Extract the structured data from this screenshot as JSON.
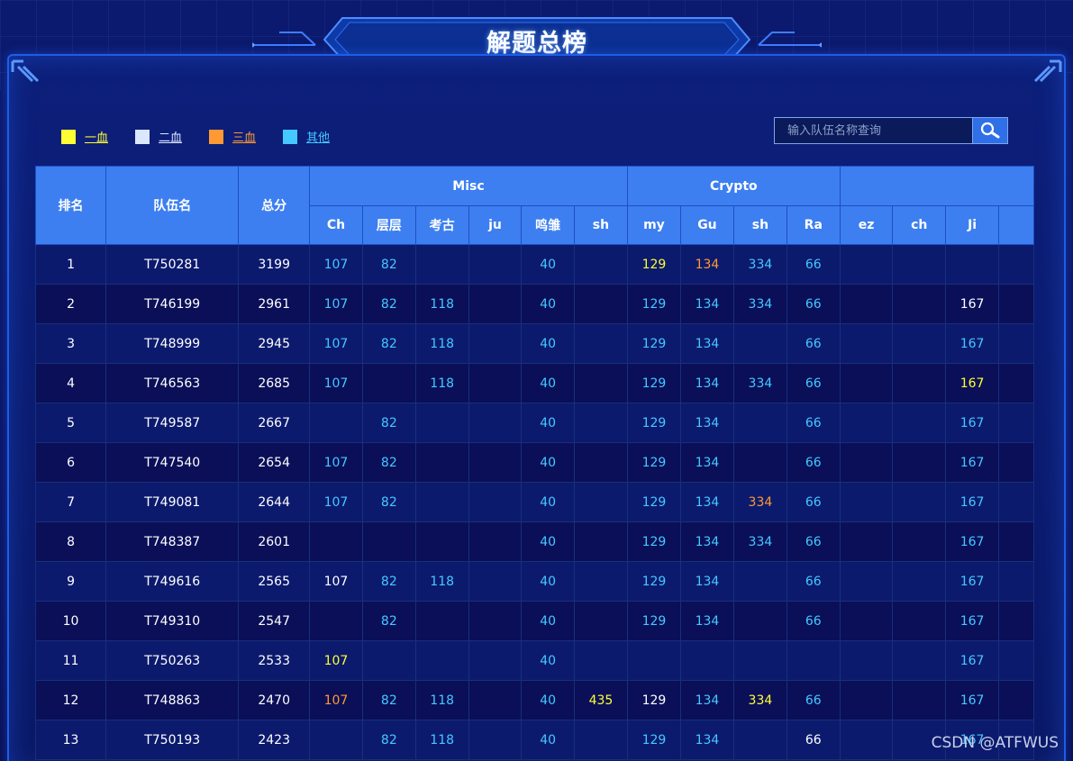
{
  "title": "解题总榜",
  "legend": [
    {
      "label": "一血",
      "color": "#ffff33"
    },
    {
      "label": "二血",
      "color": "#dbe6ff"
    },
    {
      "label": "三血",
      "color": "#ff9933"
    },
    {
      "label": "其他",
      "color": "#45c8ff"
    }
  ],
  "search": {
    "placeholder": "输入队伍名称查询",
    "icon": "search-icon"
  },
  "colors": {
    "first": "#ffff33",
    "second": "#ffffff",
    "third": "#ff9933",
    "other": "#45c8ff",
    "header": "#3d7ff0"
  },
  "table": {
    "fixed_headers": [
      "排名",
      "队伍名",
      "总分"
    ],
    "groups": [
      {
        "name": "Misc",
        "challenges": [
          "Ch",
          "层层",
          "考古",
          "ju",
          "鸣雏",
          "sh"
        ]
      },
      {
        "name": "Crypto",
        "challenges": [
          "my",
          "Gu",
          "sh",
          "Ra"
        ]
      },
      {
        "name": "",
        "challenges": [
          "ez",
          "ch",
          "Ji",
          ""
        ]
      }
    ],
    "rows": [
      {
        "rank": "1",
        "team": "T750281",
        "total": "3199",
        "scores": [
          [
            "107",
            "o"
          ],
          [
            "82",
            "o"
          ],
          [
            "",
            ""
          ],
          [
            "",
            ""
          ],
          [
            "40",
            "o"
          ],
          [
            "",
            ""
          ],
          [
            "129",
            "f"
          ],
          [
            "134",
            "t"
          ],
          [
            "334",
            "o"
          ],
          [
            "66",
            "o"
          ],
          [
            "",
            ""
          ],
          [
            "",
            ""
          ],
          [
            "",
            ""
          ],
          [
            "",
            ""
          ]
        ]
      },
      {
        "rank": "2",
        "team": "T746199",
        "total": "2961",
        "scores": [
          [
            "107",
            "o"
          ],
          [
            "82",
            "o"
          ],
          [
            "118",
            "o"
          ],
          [
            "",
            ""
          ],
          [
            "40",
            "o"
          ],
          [
            "",
            ""
          ],
          [
            "129",
            "o"
          ],
          [
            "134",
            "o"
          ],
          [
            "334",
            "o"
          ],
          [
            "66",
            "o"
          ],
          [
            "",
            ""
          ],
          [
            "",
            ""
          ],
          [
            "167",
            "s"
          ],
          [
            "",
            ""
          ]
        ]
      },
      {
        "rank": "3",
        "team": "T748999",
        "total": "2945",
        "scores": [
          [
            "107",
            "o"
          ],
          [
            "82",
            "o"
          ],
          [
            "118",
            "o"
          ],
          [
            "",
            ""
          ],
          [
            "40",
            "o"
          ],
          [
            "",
            ""
          ],
          [
            "129",
            "o"
          ],
          [
            "134",
            "o"
          ],
          [
            "",
            ""
          ],
          [
            "66",
            "o"
          ],
          [
            "",
            ""
          ],
          [
            "",
            ""
          ],
          [
            "167",
            "o"
          ],
          [
            "",
            ""
          ]
        ]
      },
      {
        "rank": "4",
        "team": "T746563",
        "total": "2685",
        "scores": [
          [
            "107",
            "o"
          ],
          [
            "",
            ""
          ],
          [
            "118",
            "o"
          ],
          [
            "",
            ""
          ],
          [
            "40",
            "o"
          ],
          [
            "",
            ""
          ],
          [
            "129",
            "o"
          ],
          [
            "134",
            "o"
          ],
          [
            "334",
            "o"
          ],
          [
            "66",
            "o"
          ],
          [
            "",
            ""
          ],
          [
            "",
            ""
          ],
          [
            "167",
            "f"
          ],
          [
            "",
            ""
          ]
        ]
      },
      {
        "rank": "5",
        "team": "T749587",
        "total": "2667",
        "scores": [
          [
            "",
            ""
          ],
          [
            "82",
            "o"
          ],
          [
            "",
            ""
          ],
          [
            "",
            ""
          ],
          [
            "40",
            "o"
          ],
          [
            "",
            ""
          ],
          [
            "129",
            "o"
          ],
          [
            "134",
            "o"
          ],
          [
            "",
            ""
          ],
          [
            "66",
            "o"
          ],
          [
            "",
            ""
          ],
          [
            "",
            ""
          ],
          [
            "167",
            "o"
          ],
          [
            "",
            ""
          ]
        ]
      },
      {
        "rank": "6",
        "team": "T747540",
        "total": "2654",
        "scores": [
          [
            "107",
            "o"
          ],
          [
            "82",
            "o"
          ],
          [
            "",
            ""
          ],
          [
            "",
            ""
          ],
          [
            "40",
            "o"
          ],
          [
            "",
            ""
          ],
          [
            "129",
            "o"
          ],
          [
            "134",
            "o"
          ],
          [
            "",
            ""
          ],
          [
            "66",
            "o"
          ],
          [
            "",
            ""
          ],
          [
            "",
            ""
          ],
          [
            "167",
            "o"
          ],
          [
            "",
            ""
          ]
        ]
      },
      {
        "rank": "7",
        "team": "T749081",
        "total": "2644",
        "scores": [
          [
            "107",
            "o"
          ],
          [
            "82",
            "o"
          ],
          [
            "",
            ""
          ],
          [
            "",
            ""
          ],
          [
            "40",
            "o"
          ],
          [
            "",
            ""
          ],
          [
            "129",
            "o"
          ],
          [
            "134",
            "o"
          ],
          [
            "334",
            "t"
          ],
          [
            "66",
            "o"
          ],
          [
            "",
            ""
          ],
          [
            "",
            ""
          ],
          [
            "167",
            "o"
          ],
          [
            "",
            ""
          ]
        ]
      },
      {
        "rank": "8",
        "team": "T748387",
        "total": "2601",
        "scores": [
          [
            "",
            ""
          ],
          [
            "",
            ""
          ],
          [
            "",
            ""
          ],
          [
            "",
            ""
          ],
          [
            "40",
            "o"
          ],
          [
            "",
            ""
          ],
          [
            "129",
            "o"
          ],
          [
            "134",
            "o"
          ],
          [
            "334",
            "o"
          ],
          [
            "66",
            "o"
          ],
          [
            "",
            ""
          ],
          [
            "",
            ""
          ],
          [
            "167",
            "o"
          ],
          [
            "",
            ""
          ]
        ]
      },
      {
        "rank": "9",
        "team": "T749616",
        "total": "2565",
        "scores": [
          [
            "107",
            "s"
          ],
          [
            "82",
            "o"
          ],
          [
            "118",
            "o"
          ],
          [
            "",
            ""
          ],
          [
            "40",
            "o"
          ],
          [
            "",
            ""
          ],
          [
            "129",
            "o"
          ],
          [
            "134",
            "o"
          ],
          [
            "",
            ""
          ],
          [
            "66",
            "o"
          ],
          [
            "",
            ""
          ],
          [
            "",
            ""
          ],
          [
            "167",
            "o"
          ],
          [
            "",
            ""
          ]
        ]
      },
      {
        "rank": "10",
        "team": "T749310",
        "total": "2547",
        "scores": [
          [
            "",
            ""
          ],
          [
            "82",
            "o"
          ],
          [
            "",
            ""
          ],
          [
            "",
            ""
          ],
          [
            "40",
            "o"
          ],
          [
            "",
            ""
          ],
          [
            "129",
            "o"
          ],
          [
            "134",
            "o"
          ],
          [
            "",
            ""
          ],
          [
            "66",
            "o"
          ],
          [
            "",
            ""
          ],
          [
            "",
            ""
          ],
          [
            "167",
            "o"
          ],
          [
            "",
            ""
          ]
        ]
      },
      {
        "rank": "11",
        "team": "T750263",
        "total": "2533",
        "scores": [
          [
            "107",
            "f"
          ],
          [
            "",
            ""
          ],
          [
            "",
            ""
          ],
          [
            "",
            ""
          ],
          [
            "40",
            "o"
          ],
          [
            "",
            ""
          ],
          [
            "",
            ""
          ],
          [
            "",
            ""
          ],
          [
            "",
            ""
          ],
          [
            "",
            ""
          ],
          [
            "",
            ""
          ],
          [
            "",
            ""
          ],
          [
            "167",
            "o"
          ],
          [
            "",
            ""
          ]
        ]
      },
      {
        "rank": "12",
        "team": "T748863",
        "total": "2470",
        "scores": [
          [
            "107",
            "t"
          ],
          [
            "82",
            "o"
          ],
          [
            "118",
            "o"
          ],
          [
            "",
            ""
          ],
          [
            "40",
            "o"
          ],
          [
            "435",
            "f"
          ],
          [
            "129",
            "s"
          ],
          [
            "134",
            "o"
          ],
          [
            "334",
            "f"
          ],
          [
            "66",
            "o"
          ],
          [
            "",
            ""
          ],
          [
            "",
            ""
          ],
          [
            "167",
            "o"
          ],
          [
            "",
            ""
          ]
        ]
      },
      {
        "rank": "13",
        "team": "T750193",
        "total": "2423",
        "scores": [
          [
            "",
            ""
          ],
          [
            "82",
            "o"
          ],
          [
            "118",
            "o"
          ],
          [
            "",
            ""
          ],
          [
            "40",
            "o"
          ],
          [
            "",
            ""
          ],
          [
            "129",
            "o"
          ],
          [
            "134",
            "o"
          ],
          [
            "",
            ""
          ],
          [
            "66",
            "s"
          ],
          [
            "",
            ""
          ],
          [
            "",
            ""
          ],
          [
            "167",
            "o"
          ],
          [
            "",
            ""
          ]
        ]
      }
    ]
  },
  "watermark": "CSDN @ATFWUS"
}
